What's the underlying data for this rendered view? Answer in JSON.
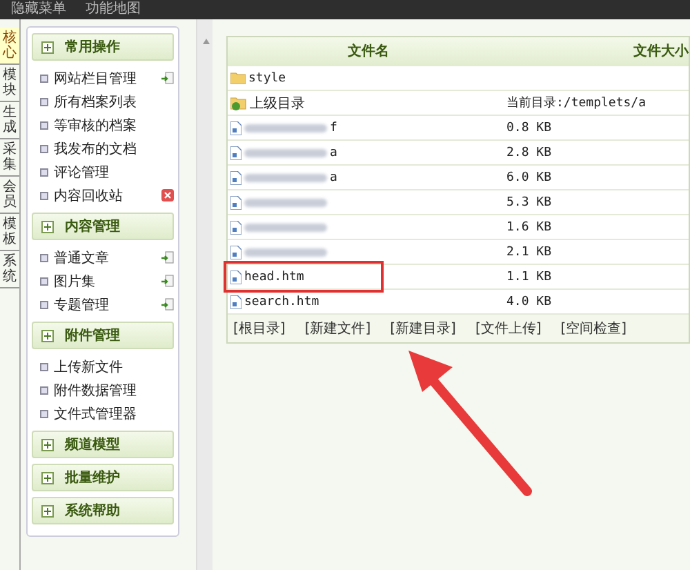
{
  "top_bar": {
    "items": [
      "隐藏菜单",
      "功能地图"
    ]
  },
  "side_tabs": [
    {
      "label": "核心",
      "selected": true
    },
    {
      "label": "模块",
      "selected": false
    },
    {
      "label": "生成",
      "selected": false
    },
    {
      "label": "采集",
      "selected": false
    },
    {
      "label": "会员",
      "selected": false
    },
    {
      "label": "模板",
      "selected": false
    },
    {
      "label": "系统",
      "selected": false
    }
  ],
  "menu_groups": [
    {
      "title": "常用操作",
      "items": [
        {
          "label": "网站栏目管理",
          "kind": "add"
        },
        {
          "label": "所有档案列表",
          "kind": "plain"
        },
        {
          "label": "等审核的档案",
          "kind": "plain"
        },
        {
          "label": "我发布的文档",
          "kind": "plain"
        },
        {
          "label": "评论管理",
          "kind": "plain"
        },
        {
          "label": "内容回收站",
          "kind": "trash"
        }
      ]
    },
    {
      "title": "内容管理",
      "items": [
        {
          "label": "普通文章",
          "kind": "add"
        },
        {
          "label": "图片集",
          "kind": "add"
        },
        {
          "label": "专题管理",
          "kind": "add"
        }
      ]
    },
    {
      "title": "附件管理",
      "items": [
        {
          "label": "上传新文件",
          "kind": "plain"
        },
        {
          "label": "附件数据管理",
          "kind": "plain"
        },
        {
          "label": "文件式管理器",
          "kind": "plain"
        }
      ]
    },
    {
      "title": "频道模型"
    },
    {
      "title": "批量维护"
    },
    {
      "title": "系统帮助"
    }
  ],
  "file_table": {
    "columns": [
      "文件名",
      "文件大小"
    ],
    "rows": [
      {
        "kind": "folder",
        "name": "style"
      },
      {
        "kind": "parent",
        "name": "上级目录",
        "size": "当前目录:/templets/a"
      },
      {
        "kind": "blurred_file",
        "name": "f",
        "size": "0.8 KB"
      },
      {
        "kind": "blurred_file",
        "name": "a",
        "size": "2.8 KB"
      },
      {
        "kind": "blurred_file",
        "name": "a",
        "size": "6.0 KB"
      },
      {
        "kind": "blurred_file",
        "size": "5.3 KB"
      },
      {
        "kind": "blurred_file",
        "size": "1.6 KB"
      },
      {
        "kind": "blurred_file",
        "size": "2.1 KB"
      },
      {
        "kind": "file",
        "name": "head.htm",
        "size": "1.1 KB",
        "highlighted": true
      },
      {
        "kind": "file",
        "name": "search.htm",
        "size": "4.0 KB"
      }
    ],
    "actions": [
      "[根目录]",
      "[新建文件]",
      "[新建目录]",
      "[文件上传]",
      "[空间检查]"
    ]
  }
}
